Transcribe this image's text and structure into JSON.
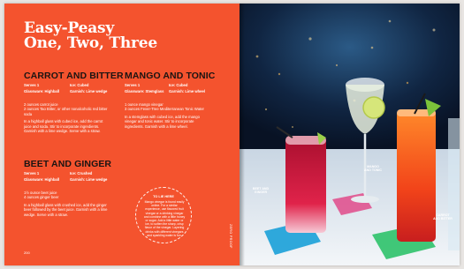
{
  "left_page": {
    "title_line1": "Easy-Peasy",
    "title_line2": "One, Two, Three",
    "recipes": [
      {
        "name": "CARROT AND BITTER",
        "serves": "Serves 1",
        "ice": "Ice: Cubed",
        "glass": "Glassware: Highball",
        "garnish": "Garnish: Lime wedge",
        "ingredients": "2 ounces carrot juice\n2 ounces Tao Bitter, or other nonalcoholic red bitter soda",
        "method": "In a highball glass with cubed ice, add the carrot juice and soda. Stir to incorporate ingredients. Garnish with a lime wedge. Serve with a straw."
      },
      {
        "name": "MANGO AND TONIC",
        "serves": "Serves 1",
        "ice": "Ice: Cubed",
        "glass": "Glassware: Stemglass",
        "garnish": "Garnish: Lime wheel",
        "ingredients": "1 ounce mango vinegar\n3 ounces Fever-Tree Mediterranean Tonic Water",
        "method": "In a stemglass with cubed ice, add the mango vinegar and tonic water. Stir to incorporate ingredients. Garnish with a lime wheel."
      },
      {
        "name": "BEET AND GINGER",
        "serves": "Serves 1",
        "ice": "Ice: Crushed",
        "glass": "Glassware: Highball",
        "garnish": "Garnish: Lime wedge",
        "ingredients": "1½ ounce beet juice\n4 ounces ginger beer",
        "method": "In a highball glass with crushed ice, add the ginger beer followed by the beet juice. Garnish with a lime wedge. Serve with a straw."
      }
    ],
    "tip_label": "TO LIE HERE",
    "tip_text": "Mango vinegar is found easily online. For a similar experience, use flavored fruit vinegar or a drinking vinegar and combine with a little honey or sugar. Add a little water or ice, to soften the sharp, crisp flavor of the vinegar. Layering drinks with different vinegars and sparkling water is fun.",
    "vertical_label": "ZERO PROOF",
    "page_number": "200"
  },
  "right_page": {
    "labels": {
      "beet": "BEET AND\nGINGER",
      "mango": "MANGO\nAND TONIC",
      "carrot": "CARROT\nAND BITTER"
    }
  },
  "colors": {
    "page_orange": "#f4532e",
    "heading_dark": "#1b1412",
    "beet": "#c8183a",
    "carrot": "#f25a1e",
    "mango": "#eef0d8"
  }
}
